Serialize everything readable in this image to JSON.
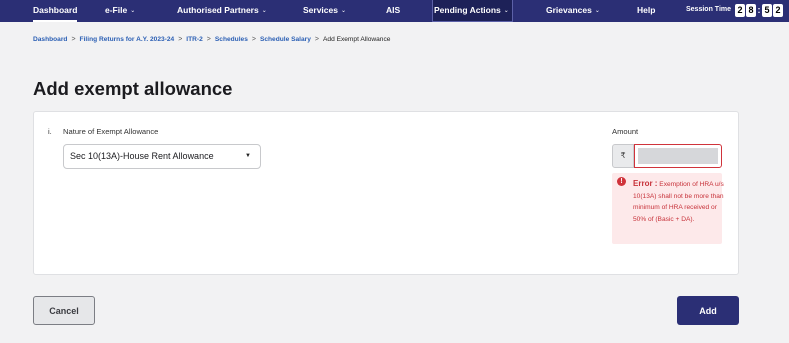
{
  "nav": {
    "dashboard": "Dashboard",
    "efile": "e-File",
    "partners": "Authorised Partners",
    "services": "Services",
    "ais": "AIS",
    "pending": "Pending Actions",
    "grievances": "Grievances",
    "help": "Help",
    "session_label": "Session Time",
    "timer_digits": [
      "2",
      "8",
      ":",
      "5",
      "2"
    ],
    "dropdown_caret": "⌄"
  },
  "breadcrumb": {
    "items": [
      "Dashboard",
      "Filing Returns for A.Y. 2023-24",
      "ITR-2",
      "Schedules",
      "Schedule Salary"
    ],
    "current": "Add Exempt Allowance",
    "separator": ">"
  },
  "page_title": "Add exempt allowance",
  "form": {
    "item_number": "i.",
    "nature_label": "Nature of Exempt Allowance",
    "nature_value": "Sec 10(13A)-House Rent Allowance",
    "amount_label": "Amount",
    "currency_symbol": "₹",
    "error_icon": "!",
    "error_title": "Error :",
    "error_message": "Exemption of HRA u/s 10(13A) shall not be more than minimum of HRA received or 50% of (Basic + DA)."
  },
  "buttons": {
    "cancel": "Cancel",
    "add": "Add"
  },
  "colors": {
    "nav_bg": "#2b2f75",
    "link": "#2b5fb4",
    "error": "#d0333b",
    "error_bg": "#fde9ea"
  }
}
